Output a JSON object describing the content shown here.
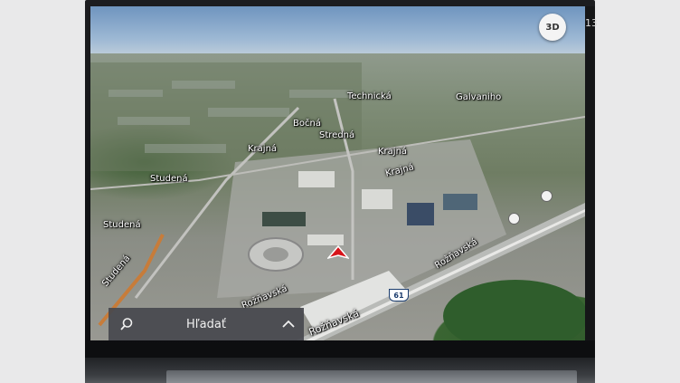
{
  "map": {
    "view_mode_button": "3D",
    "labels": {
      "technicka": "Technická",
      "galvaniho": "Galvaniho",
      "bocna": "Bočná",
      "stredna": "Stredná",
      "krajna_1": "Krajná",
      "krajna_2": "Krajná",
      "krajna_3": "Krajná",
      "studena_1": "Studená",
      "studena_2": "Studená",
      "studena_3": "Studená",
      "roznavska_1": "Rožňavská",
      "roznavska_2": "Rožňavská",
      "roznavska_3": "Rožňavská"
    },
    "road_shield": "61"
  },
  "search": {
    "label": "Hľadať"
  },
  "status_strip": {
    "time_partial": "13"
  },
  "colors": {
    "nav_arrow": "#d7141a",
    "search_bar_bg": "#46484e"
  },
  "icons": {
    "search": "search-icon",
    "expand": "chevron-up-icon",
    "position": "navigation-arrow-icon"
  }
}
